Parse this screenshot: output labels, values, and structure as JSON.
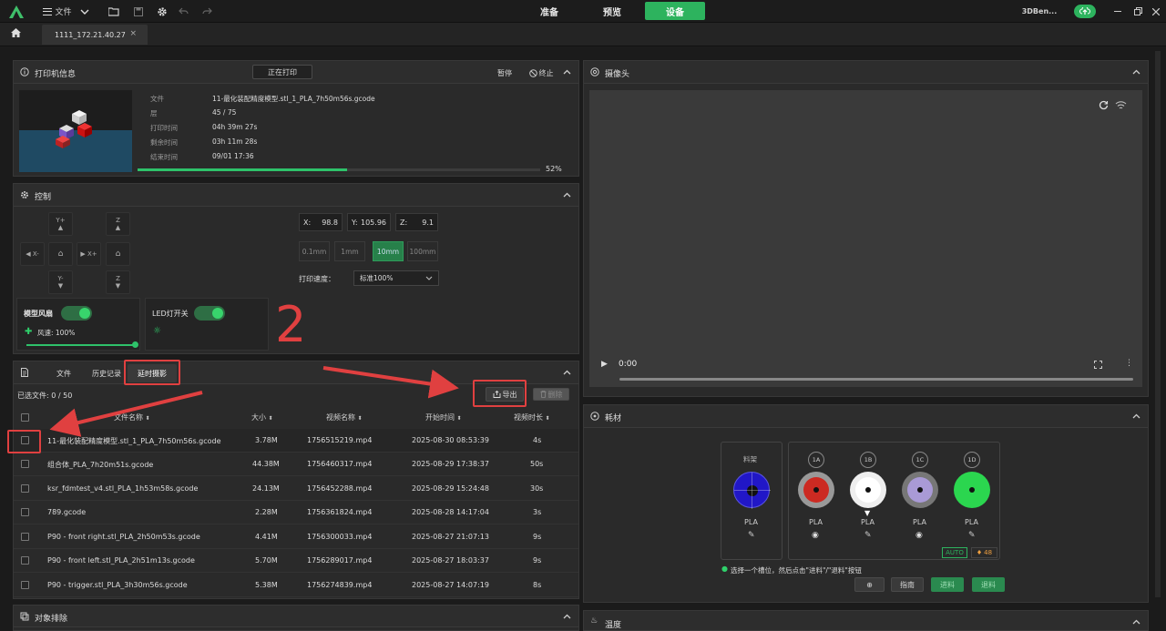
{
  "titlebar": {
    "file_menu": "文件",
    "modes": [
      "准备",
      "预览",
      "设备"
    ],
    "active_mode": "设备",
    "project_name": "3DBen..."
  },
  "tabbar": {
    "device_tab": "1111_172.21.40.27",
    "close": "×"
  },
  "printer_info": {
    "title": "打印机信息",
    "status": "正在打印",
    "pause_label": "暂停",
    "stop_label": "终止",
    "fields": [
      {
        "label": "文件",
        "value": "11-最化装配精度模型.stl_1_PLA_7h50m56s.gcode"
      },
      {
        "label": "层",
        "value": "45 / 75"
      },
      {
        "label": "打印时间",
        "value": "04h 39m 27s"
      },
      {
        "label": "剩余时间",
        "value": "03h 11m 28s"
      },
      {
        "label": "结束时间",
        "value": "09/01 17:36"
      }
    ],
    "progress": 52,
    "progress_text": "52%"
  },
  "control": {
    "title": "控制",
    "jog": {
      "yplus": "Y+",
      "yminus": "Y-",
      "xminus": "X-",
      "xplus": "X+",
      "z": "Z"
    },
    "coords": [
      {
        "axis": "X:",
        "value": "98.8"
      },
      {
        "axis": "Y:",
        "value": "105.96"
      },
      {
        "axis": "Z:",
        "value": "9.1"
      }
    ],
    "steps": [
      "0.1mm",
      "1mm",
      "10mm",
      "100mm"
    ],
    "active_step": "10mm",
    "speed_label": "打印速度：",
    "speed_value": "标准100%",
    "fan_label": "模型风扇",
    "fan_speed": "风速: 100%",
    "fan_level": 100,
    "led_label": "LED灯开关",
    "annotation": "2"
  },
  "files": {
    "tabs": [
      "文件",
      "历史记录",
      "延时摄影"
    ],
    "active_tab": "延时摄影",
    "selected_count": "已选文件: 0 / 50",
    "export_label": "导出",
    "delete_label": "删除",
    "columns": [
      "文件名称",
      "大小",
      "视频名称",
      "开始时间",
      "视频时长"
    ],
    "rows": [
      {
        "name": "11-最化装配精度模型.stl_1_PLA_7h50m56s.gcode",
        "size": "3.78M",
        "video": "1756515219.mp4",
        "start": "2025-08-30 08:53:39",
        "duration": "4s"
      },
      {
        "name": "组合体_PLA_7h20m51s.gcode",
        "size": "44.38M",
        "video": "1756460317.mp4",
        "start": "2025-08-29 17:38:37",
        "duration": "50s"
      },
      {
        "name": "ksr_fdmtest_v4.stl_PLA_1h53m58s.gcode",
        "size": "24.13M",
        "video": "1756452288.mp4",
        "start": "2025-08-29 15:24:48",
        "duration": "30s"
      },
      {
        "name": "789.gcode",
        "size": "2.28M",
        "video": "1756361824.mp4",
        "start": "2025-08-28 14:17:04",
        "duration": "3s"
      },
      {
        "name": "P90 - front right.stl_PLA_2h50m53s.gcode",
        "size": "4.41M",
        "video": "1756300033.mp4",
        "start": "2025-08-27 21:07:13",
        "duration": "9s"
      },
      {
        "name": "P90 - front left.stl_PLA_2h51m13s.gcode",
        "size": "5.70M",
        "video": "1756289017.mp4",
        "start": "2025-08-27 18:03:37",
        "duration": "9s"
      },
      {
        "name": "P90 - trigger.stl_PLA_3h30m56s.gcode",
        "size": "5.38M",
        "video": "1756274839.mp4",
        "start": "2025-08-27 14:07:19",
        "duration": "8s"
      }
    ]
  },
  "object_exclusion": {
    "title": "对象排除"
  },
  "camera": {
    "title": "摄像头",
    "time": "0:00"
  },
  "filament": {
    "title": "耗材",
    "rack_label": "料架",
    "rack_type": "PLA",
    "slots": [
      {
        "tag": "1A",
        "type": "PLA",
        "color": "#cc2a22"
      },
      {
        "tag": "1B",
        "type": "PLA",
        "color": "#ffffff"
      },
      {
        "tag": "1C",
        "type": "PLA",
        "color": "#a99ad6"
      },
      {
        "tag": "1D",
        "type": "PLA",
        "color": "#2bd64f"
      }
    ],
    "auto_label": "AUTO",
    "humidity": "48",
    "hint": "选择一个槽位，然后点击\"进料\"/\"退料\"按钮",
    "guide_label": "指南",
    "load_label": "进料",
    "unload_label": "退料"
  },
  "temperature": {
    "title": "温度"
  }
}
